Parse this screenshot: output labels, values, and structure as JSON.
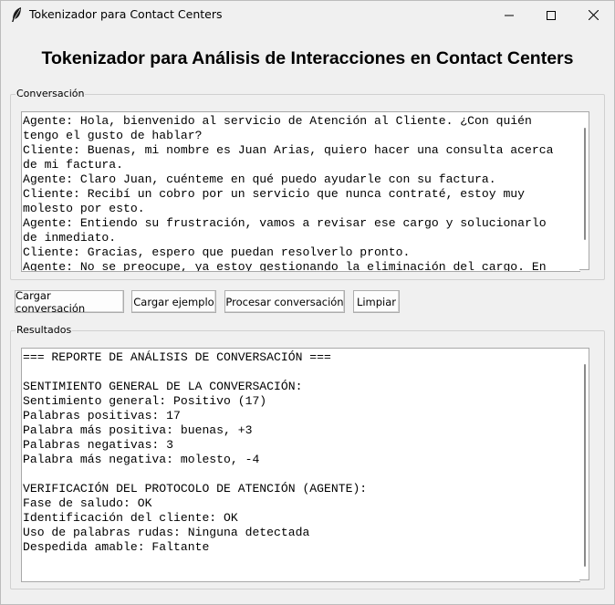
{
  "window": {
    "title": "Tokenizador para Contact Centers",
    "app_icon": "feather-icon",
    "controls": [
      "minimize-icon",
      "maximize-icon",
      "close-icon"
    ]
  },
  "heading": "Tokenizador para Análisis de Interacciones en Contact Centers",
  "conversation": {
    "label": "Conversación",
    "lines": [
      "Agente: Hola, bienvenido al servicio de Atención al Cliente. ¿Con quién",
      "tengo el gusto de hablar?",
      "Cliente: Buenas, mi nombre es Juan Arias, quiero hacer una consulta acerca",
      "de mi factura.",
      "Agente: Claro Juan, cuénteme en qué puedo ayudarle con su factura.",
      "Cliente: Recibí un cobro por un servicio que nunca contraté, estoy muy",
      "molesto por esto.",
      "Agente: Entiendo su frustración, vamos a revisar ese cargo y solucionarlo",
      "de inmediato.",
      "Cliente: Gracias, espero que puedan resolverlo pronto.",
      "Agente: No se preocupe, ya estoy gestionando la eliminación del cargo. En"
    ]
  },
  "buttons": {
    "load_conversation": "Cargar conversación",
    "load_example": "Cargar ejemplo",
    "process": "Procesar conversación",
    "clear": "Limpiar"
  },
  "results": {
    "label": "Resultados",
    "lines": [
      "=== REPORTE DE ANÁLISIS DE CONVERSACIÓN ===",
      "",
      "SENTIMIENTO GENERAL DE LA CONVERSACIÓN:",
      "Sentimiento general: Positivo (17)",
      "Palabras positivas: 17",
      "Palabra más positiva: buenas, +3",
      "Palabras negativas: 3",
      "Palabra más negativa: molesto, -4",
      "",
      "VERIFICACIÓN DEL PROTOCOLO DE ATENCIÓN (AGENTE):",
      "Fase de saludo: OK",
      "Identificación del cliente: OK",
      "Uso de palabras rudas: Ninguna detectada",
      "Despedida amable: Faltante"
    ]
  }
}
